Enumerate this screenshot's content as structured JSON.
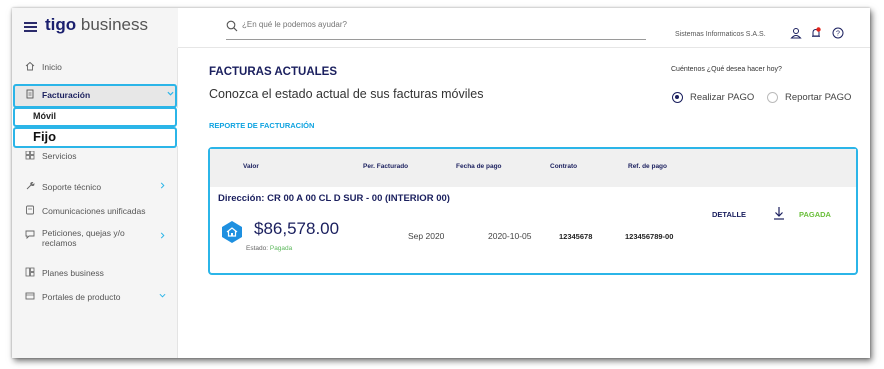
{
  "header": {
    "logo_brand": "tigo",
    "logo_suffix": "business",
    "search_placeholder": "¿En qué le podemos ayudar?",
    "company": "Sistemas Informaticos S.A.S."
  },
  "sidebar": {
    "items": [
      {
        "label": "Inicio",
        "icon": "home-icon"
      },
      {
        "label": "Facturación",
        "icon": "document-icon"
      },
      {
        "label": "Servicios",
        "icon": "grid-icon"
      },
      {
        "label": "Soporte técnico",
        "icon": "wrench-icon"
      },
      {
        "label": "Comunicaciones unificadas",
        "icon": "chat-icon"
      },
      {
        "label": "Peticiones, quejas y/o reclamos",
        "icon": "message-icon"
      },
      {
        "label": "Planes business",
        "icon": "plans-icon"
      },
      {
        "label": "Portales de producto",
        "icon": "portal-icon"
      }
    ],
    "submenu": {
      "movil": "Móvil",
      "fijo": "Fijo"
    }
  },
  "main": {
    "title": "FACTURAS ACTUALES",
    "subtitle": "Conozca el estado actual de sus facturas móviles",
    "report_link": "REPORTE DE FACTURACIÓN",
    "question": "Cuéntenos ¿Qué desea hacer hoy?",
    "option_pay": "Realizar PAGO",
    "option_report": "Reportar PAGO"
  },
  "table": {
    "headers": [
      "Valor",
      "Per. Facturado",
      "Fecha de pago",
      "Contrato",
      "Ref. de pago"
    ],
    "address": "Dirección: CR 00 A 00 CL D SUR - 00 (INTERIOR 00)",
    "amount": "$86,578.00",
    "estado_label": "Estado:",
    "estado_value": "Pagada",
    "period": "Sep 2020",
    "pay_date": "2020-10-05",
    "contract": "12345678",
    "reference": "123456789-00",
    "detail": "DETALLE",
    "status": "PAGADA"
  },
  "colors": {
    "accent": "#2bb5e8",
    "brand": "#1a1f5e",
    "success": "#6abf3a"
  }
}
